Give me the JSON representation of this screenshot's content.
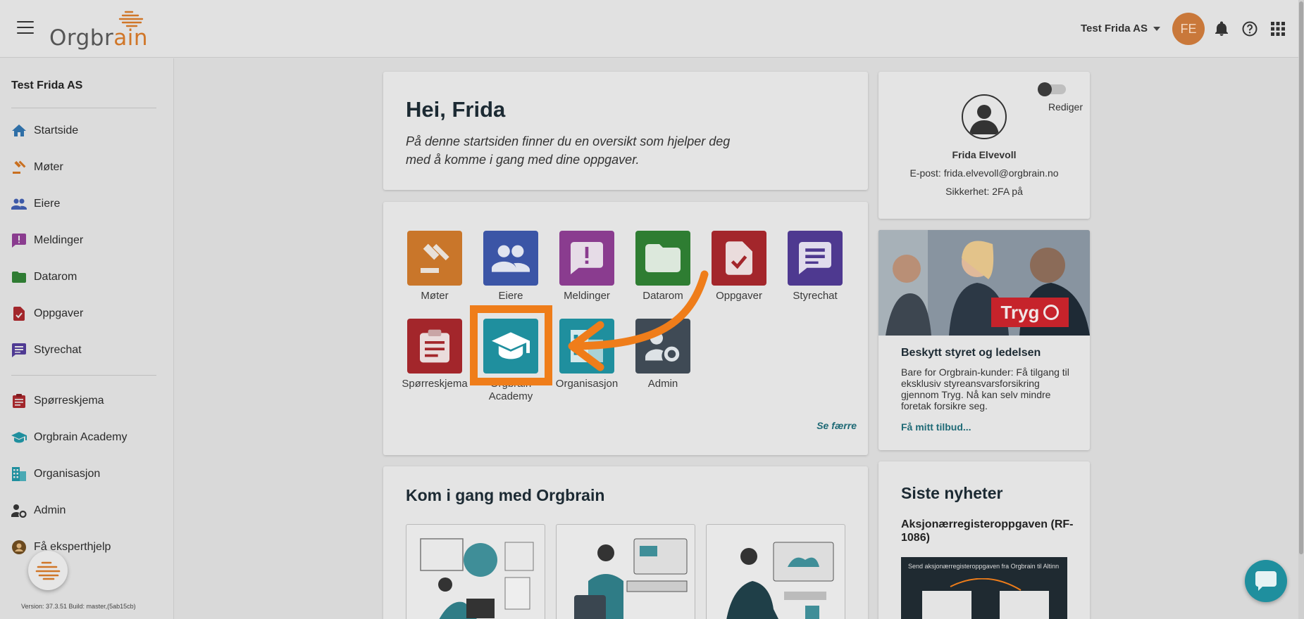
{
  "topbar": {
    "logo_prefix": "Orgbr",
    "logo_suffix": "ain",
    "org_selector": "Test Frida AS",
    "avatar_initials": "FE",
    "icons": [
      "bell-icon",
      "help-icon",
      "apps-grid-icon"
    ]
  },
  "sidebar": {
    "org_name": "Test Frida AS",
    "items": [
      {
        "label": "Startside",
        "icon": "home-icon",
        "color": "#2f6fa7"
      },
      {
        "label": "Møter",
        "icon": "gavel-icon",
        "color": "#c96f1f"
      },
      {
        "label": "Eiere",
        "icon": "people-icon",
        "color": "#3d5aa8"
      },
      {
        "label": "Meldinger",
        "icon": "message-alert-icon",
        "color": "#8a3c8f"
      },
      {
        "label": "Datarom",
        "icon": "folder-icon",
        "color": "#2f7c33"
      },
      {
        "label": "Oppgaver",
        "icon": "task-icon",
        "color": "#a2262b"
      },
      {
        "label": "Styrechat",
        "icon": "chat-icon",
        "color": "#4f3a93"
      }
    ],
    "items2": [
      {
        "label": "Spørreskjema",
        "icon": "clipboard-icon",
        "color": "#a2262b"
      },
      {
        "label": "Orgbrain Academy",
        "icon": "graduation-cap-icon",
        "color": "#1f8f9e"
      },
      {
        "label": "Organisasjon",
        "icon": "building-icon",
        "color": "#1f8f9e"
      },
      {
        "label": "Admin",
        "icon": "admin-icon",
        "color": "#333333"
      },
      {
        "label": "Få eksperthjelp",
        "icon": "expert-icon",
        "color": "#6b4a1f"
      }
    ],
    "version": "Version: 37.3.51 Build: master,(5ab15cb)"
  },
  "hello": {
    "title": "Hei, Frida",
    "subtitle": "På denne startsiden finner du en oversikt som hjelper deg med å komme i gang med dine oppgaver."
  },
  "apps": {
    "row1": [
      {
        "label": "Møter",
        "color": "#c9762a"
      },
      {
        "label": "Eiere",
        "color": "#3b55a6"
      },
      {
        "label": "Meldinger",
        "color": "#8a3c8f"
      },
      {
        "label": "Datarom",
        "color": "#2e7d32"
      },
      {
        "label": "Oppgaver",
        "color": "#a3262b"
      },
      {
        "label": "Styrechat",
        "color": "#4e3990"
      }
    ],
    "row2": [
      {
        "label": "Spørreskjema",
        "color": "#a3262b"
      },
      {
        "label": "Orgbrain Academy",
        "color": "#1f8f9e"
      },
      {
        "label": "Organisasjon",
        "color": "#1f8f9e"
      },
      {
        "label": "Admin",
        "color": "#3f4a55"
      }
    ],
    "see_less": "Se færre"
  },
  "getstarted": {
    "title": "Kom i gang med Orgbrain"
  },
  "profile": {
    "toggle_label": "Rediger",
    "name": "Frida Elvevoll",
    "email": "E-post: frida.elvevoll@orgbrain.no",
    "security": "Sikkerhet: 2FA på"
  },
  "promo": {
    "brand": "Tryg",
    "title": "Beskytt styret og ledelsen",
    "text": "Bare for Orgbrain-kunder: Få tilgang til eksklusiv styreansvarsforsikring gjennom Tryg. Nå kan selv mindre foretak forsikre seg.",
    "link": "Få mitt tilbud..."
  },
  "news": {
    "title": "Siste nyheter",
    "headline": "Aksjonærregisteroppgaven (RF-1086)",
    "image_caption": "Send aksjonærregisteroppgaven fra Orgbrain til Altinn"
  },
  "colors": {
    "accent": "#ef7d1a",
    "link": "#1f6a76"
  }
}
